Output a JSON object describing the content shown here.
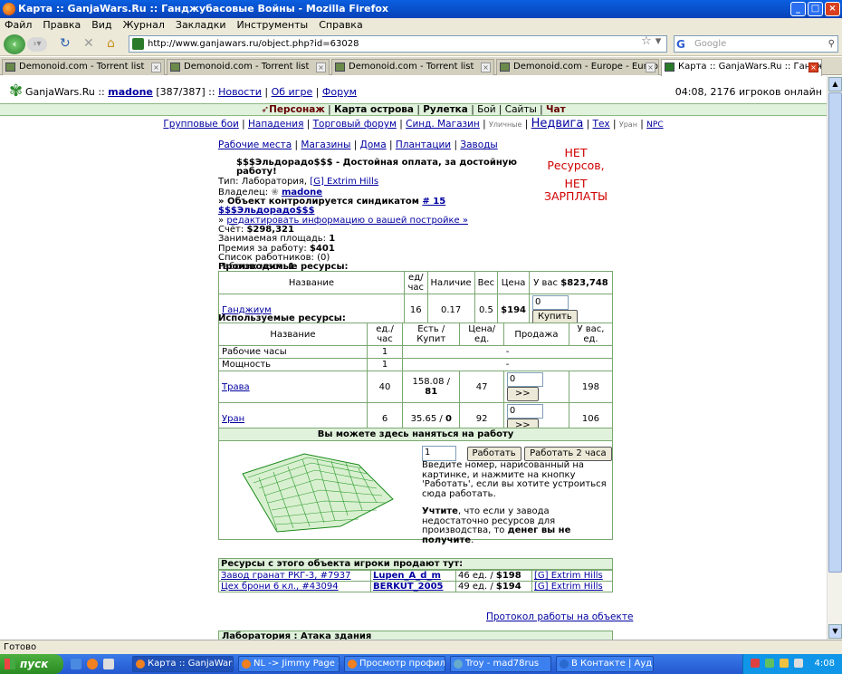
{
  "window": {
    "title": "Карта :: GanjaWars.Ru :: Ганджубасовые Войны - Mozilla Firefox"
  },
  "menu": [
    "Файл",
    "Правка",
    "Вид",
    "Журнал",
    "Закладки",
    "Инструменты",
    "Справка"
  ],
  "nav": {
    "url": "http://www.ganjawars.ru/object.php?id=63028",
    "search_placeholder": "Google"
  },
  "tabs": [
    {
      "label": "Demonoid.com - Torrent list"
    },
    {
      "label": "Demonoid.com - Torrent list"
    },
    {
      "label": "Demonoid.com - Torrent list"
    },
    {
      "label": "Demonoid.com - Europe - Europe (1983..."
    },
    {
      "label": "Карта :: GanjaWars.Ru :: Ганджу..."
    }
  ],
  "header": {
    "site": "GanjaWars.Ru",
    "sep": "::",
    "user": "madone",
    "level": "[387/387]",
    "news": "Новости",
    "about": "Об игре",
    "forum": "Форум",
    "online": "04:08, 2176 игроков онлайн"
  },
  "mainmenu": [
    "Персонаж",
    "Карта острова",
    "Рулетка",
    "Бой",
    "Сайты",
    "Чат"
  ],
  "submenu": {
    "group": "Групповые бои",
    "attacks": "Нападения",
    "trade": "Торговый форум",
    "synd": "Синд. Магазин",
    "street": "Уличные",
    "realty": "Недвига",
    "tech": "Тех",
    "uran": "Уран",
    "npc": "NPC"
  },
  "links": [
    "Рабочие места",
    "Магазины",
    "Дома",
    "Плантации",
    "Заводы"
  ],
  "banner": {
    "line1": "НЕТ",
    "line2": "Ресурсов,",
    "line3": "НЕТ",
    "line4": "ЗАРПЛАТЫ"
  },
  "object": {
    "title": "$$$Эльдорадо$$$ - Достойная оплата, за достойную работу!",
    "type_label": "Тип:",
    "type": "Лаборатория,",
    "location": "[G] Extrim Hills",
    "owner_label": "Владелец:",
    "owner": "madone",
    "controlled_prefix": "» Объект контролируется синдикатом",
    "syndicate": "# 15 $$$Эльдорадо$$$",
    "edit": "редактировать информацию о вашей постройке »",
    "edit_prefix": "»",
    "account_label": "Счёт:",
    "account": "$298,321",
    "area_label": "Занимаемая площадь:",
    "area": "1",
    "bonus_label": "Премия за работу:",
    "bonus": "$401",
    "workers_label": "Список работников:",
    "workers": "(0)",
    "slots_label": "Рабочих мест:",
    "slots": "1"
  },
  "produced": {
    "title": "Производимые ресурсы:",
    "headers": [
      "Название",
      "ед/час",
      "Наличие",
      "Вес",
      "Цена",
      "У вас"
    ],
    "you_have": "$823,748",
    "row": {
      "name": "Ганджиум",
      "rate": "16",
      "stock": "0.17",
      "weight": "0.5",
      "price": "$194",
      "qty": "0",
      "buy": "Купить"
    }
  },
  "used": {
    "title": "Используемые ресурсы:",
    "headers": [
      "Название",
      "ед./час",
      "Есть / Купит",
      "Цена/ед.",
      "Продажа",
      "У вас, ед."
    ],
    "rows": [
      {
        "name": "Рабочие часы",
        "rate": "1",
        "dash": "-"
      },
      {
        "name": "Мощность",
        "rate": "1",
        "dash": "-"
      },
      {
        "name": "Трава",
        "rate": "40",
        "have": "158.08 / ",
        "buy": "81",
        "price": "47",
        "qty": "0",
        "sell": ">>",
        "you": "198"
      },
      {
        "name": "Уран",
        "rate": "6",
        "have": "35.65 / ",
        "buy": "0",
        "price": "92",
        "qty": "0",
        "sell": ">>",
        "you": "106"
      }
    ]
  },
  "job": {
    "title": "Вы можете здесь наняться на работу",
    "input": "1",
    "work": "Работать",
    "work2": "Работать 2 часа",
    "hint": "Введите номер, нарисованный на картинке, и нажмите на кнопку 'Работать', если вы хотите устроиться сюда работать.",
    "warn_b1": "Учтите",
    "warn_1": ", что если у завода недостаточно ресурсов для производства, то ",
    "warn_b2": "денег вы не получите",
    "warn_2": "."
  },
  "sellers": {
    "title": "Ресурсы с этого объекта игроки продают тут:",
    "rows": [
      {
        "place": "Завод гранат РКГ-3, #7937",
        "player": "Lupen_A_d_m",
        "qty": "46 ед. / ",
        "price": "$198",
        "loc": "[G] Extrim Hills"
      },
      {
        "place": "Цех брони 6 кл., #43094",
        "player": "BERKUT_2005",
        "qty": "49 ед. / ",
        "price": "$194",
        "loc": "[G] Extrim Hills"
      }
    ]
  },
  "protocol": "Протокол работы на объекте",
  "attack": "Лаборатория  : Атака здания",
  "status": "Готово",
  "taskbar": {
    "start": "пуск",
    "items": [
      "Карта :: GanjaWars....",
      "NL -> Jimmy Page & ...",
      "Просмотр профиля -...",
      "Troy - mad78rus",
      "В Контакте | Аудио ..."
    ],
    "lang": "RU",
    "clock": "4:08"
  },
  "colors": {
    "accent_green": "#e0f2dc",
    "border_green": "#7aa870",
    "banner_red": "#d00000",
    "link": "#0000a0"
  }
}
